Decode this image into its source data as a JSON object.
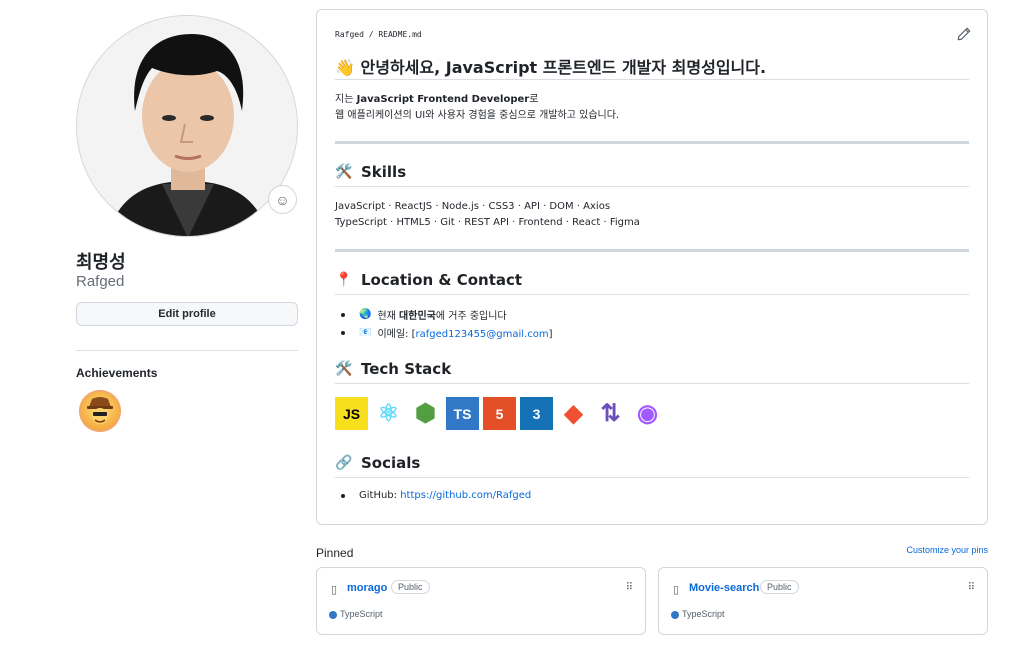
{
  "profile": {
    "name": "최명성",
    "login": "Rafged",
    "edit_label": "Edit profile",
    "achievements_title": "Achievements",
    "status_icon": "smiley-icon"
  },
  "readme": {
    "path_user": "Rafged",
    "path_sep": " / ",
    "path_file": "README.md",
    "title_emoji": "👋",
    "title": "안녕하세요, JavaScript 프론트엔드 개발자 최명성입니다.",
    "intro_prefix": "지는 ",
    "intro_bold": "JavaScript Frontend Developer",
    "intro_suffix": "로",
    "intro_line2": "웹 애플리케이션의 UI와 사용자 경험을 중심으로 개발하고 있습니다.",
    "skills": {
      "icon": "🛠️",
      "heading": "Skills",
      "line1": "JavaScript · ReactJS · Node.js · CSS3 · API · DOM · Axios",
      "line2": "TypeScript · HTML5 · Git · REST API · Frontend · React · Figma"
    },
    "location": {
      "icon": "📍",
      "heading": "Location & Contact",
      "item1_icon": "🌏",
      "item1_prefix": "현재 ",
      "item1_bold": "대한민국",
      "item1_suffix": "에 거주 중입니다",
      "item2_icon": "📧",
      "item2_prefix": "이메일: [",
      "item2_link": "rafged123455@gmail.com",
      "item2_suffix": "]"
    },
    "tech_stack": {
      "icon": "🛠️",
      "heading": "Tech Stack",
      "logos": [
        {
          "name": "javascript-logo",
          "label": "JS",
          "bg": "#f7df1e",
          "fg": "#000000"
        },
        {
          "name": "react-logo",
          "label": "⚛",
          "bg": "#ffffff",
          "fg": "#61dafb"
        },
        {
          "name": "nodejs-logo",
          "label": "⬢",
          "bg": "#ffffff",
          "fg": "#539e43"
        },
        {
          "name": "typescript-logo",
          "label": "TS",
          "bg": "#3178c6",
          "fg": "#ffffff"
        },
        {
          "name": "html5-logo",
          "label": "5",
          "bg": "#e34f26",
          "fg": "#ffffff"
        },
        {
          "name": "css3-logo",
          "label": "3",
          "bg": "#1572b6",
          "fg": "#ffffff"
        },
        {
          "name": "git-logo",
          "label": "◆",
          "bg": "#ffffff",
          "fg": "#f05032"
        },
        {
          "name": "rest-api-logo",
          "label": "⇅",
          "bg": "#ffffff",
          "fg": "#6b4fbb"
        },
        {
          "name": "figma-logo",
          "label": "◉",
          "bg": "#ffffff",
          "fg": "#a259ff"
        }
      ]
    },
    "socials": {
      "icon": "🔗",
      "heading": "Socials",
      "item_prefix": "GitHub: ",
      "item_link": "https://github.com/Rafged"
    }
  },
  "pinned": {
    "title": "Pinned",
    "customize": "Customize your pins",
    "repos": [
      {
        "name": "morago",
        "visibility": "Public",
        "language": "TypeScript",
        "lang_color": "#3178c6"
      },
      {
        "name": "Movie-search",
        "visibility": "Public",
        "language": "TypeScript",
        "lang_color": "#3178c6"
      }
    ]
  }
}
